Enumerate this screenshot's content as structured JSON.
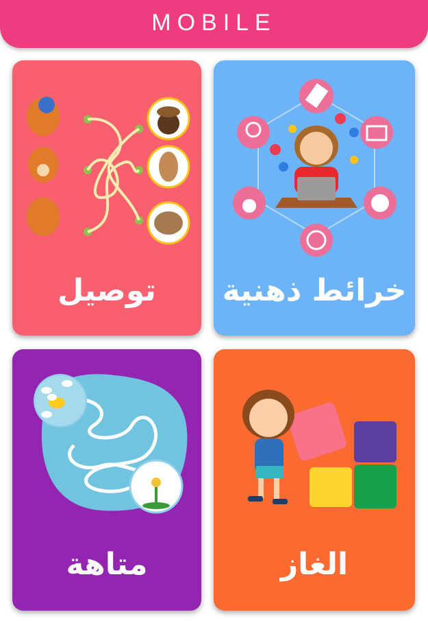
{
  "header": {
    "title": "MOBILE",
    "color": "#ee3c7f"
  },
  "cards": [
    {
      "id": "mindmaps",
      "label": "خرائط ذهنية",
      "color": "#6db3f8",
      "illustration": "girl-laptop-mindmap-icon"
    },
    {
      "id": "connect",
      "label": "توصيل",
      "color": "#f8606f",
      "illustration": "squirrels-nuts-matching-icon"
    },
    {
      "id": "puzzles",
      "label": "الغاز",
      "color": "#fb6a31",
      "illustration": "girl-jigsaw-puzzle-icon"
    },
    {
      "id": "maze",
      "label": "متاهة",
      "color": "#9425b0",
      "illustration": "bee-flower-maze-icon"
    }
  ]
}
